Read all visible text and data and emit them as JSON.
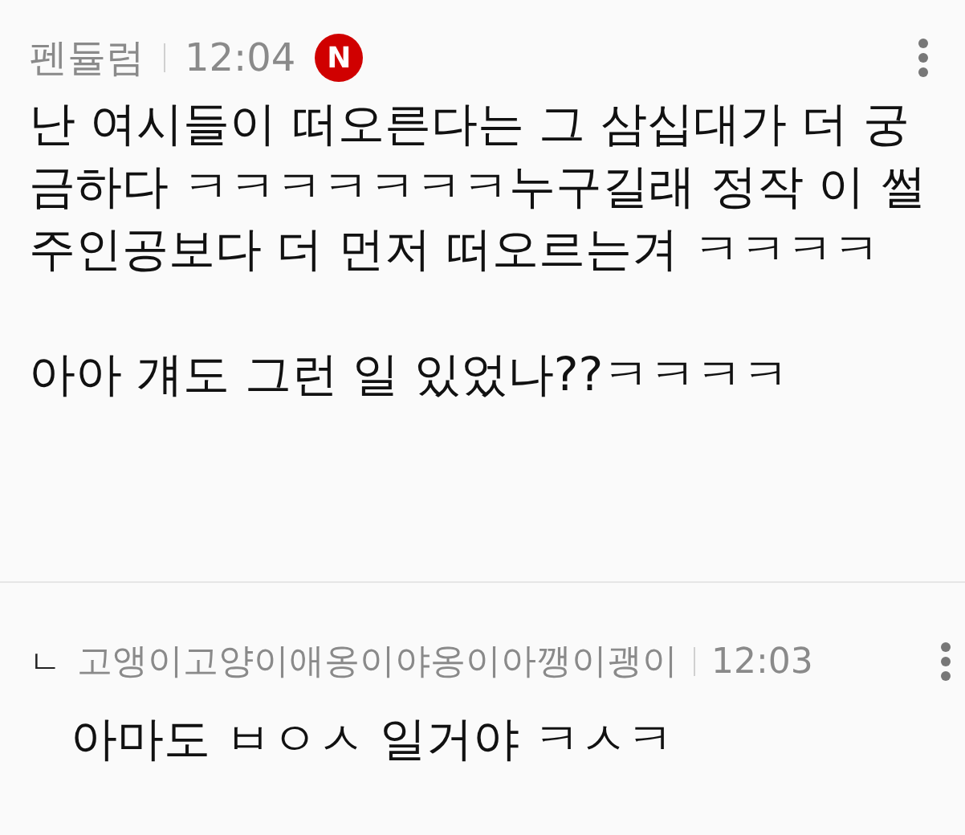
{
  "comment": {
    "author": "펜듈럼",
    "time": "12:04",
    "new_badge": "N",
    "paragraphs": [
      "난 여시들이 떠오른다는 그 삼십대가 더 궁금하다 ㅋㅋㅋㅋㅋㅋㅋ누구길래 정작 이 썰 주인공보다 더 먼저 떠오르는겨 ㅋㅋㅋㅋ",
      "아아 걔도 그런 일 있었나??ㅋㅋㅋㅋ"
    ]
  },
  "reply": {
    "marker": "ㄴ",
    "author": "고앵이고양이애옹이야옹이아깽이괭이",
    "time": "12:03",
    "text": "아마도 ㅂㅇㅅ 일거야 ㅋㅅㅋ"
  }
}
